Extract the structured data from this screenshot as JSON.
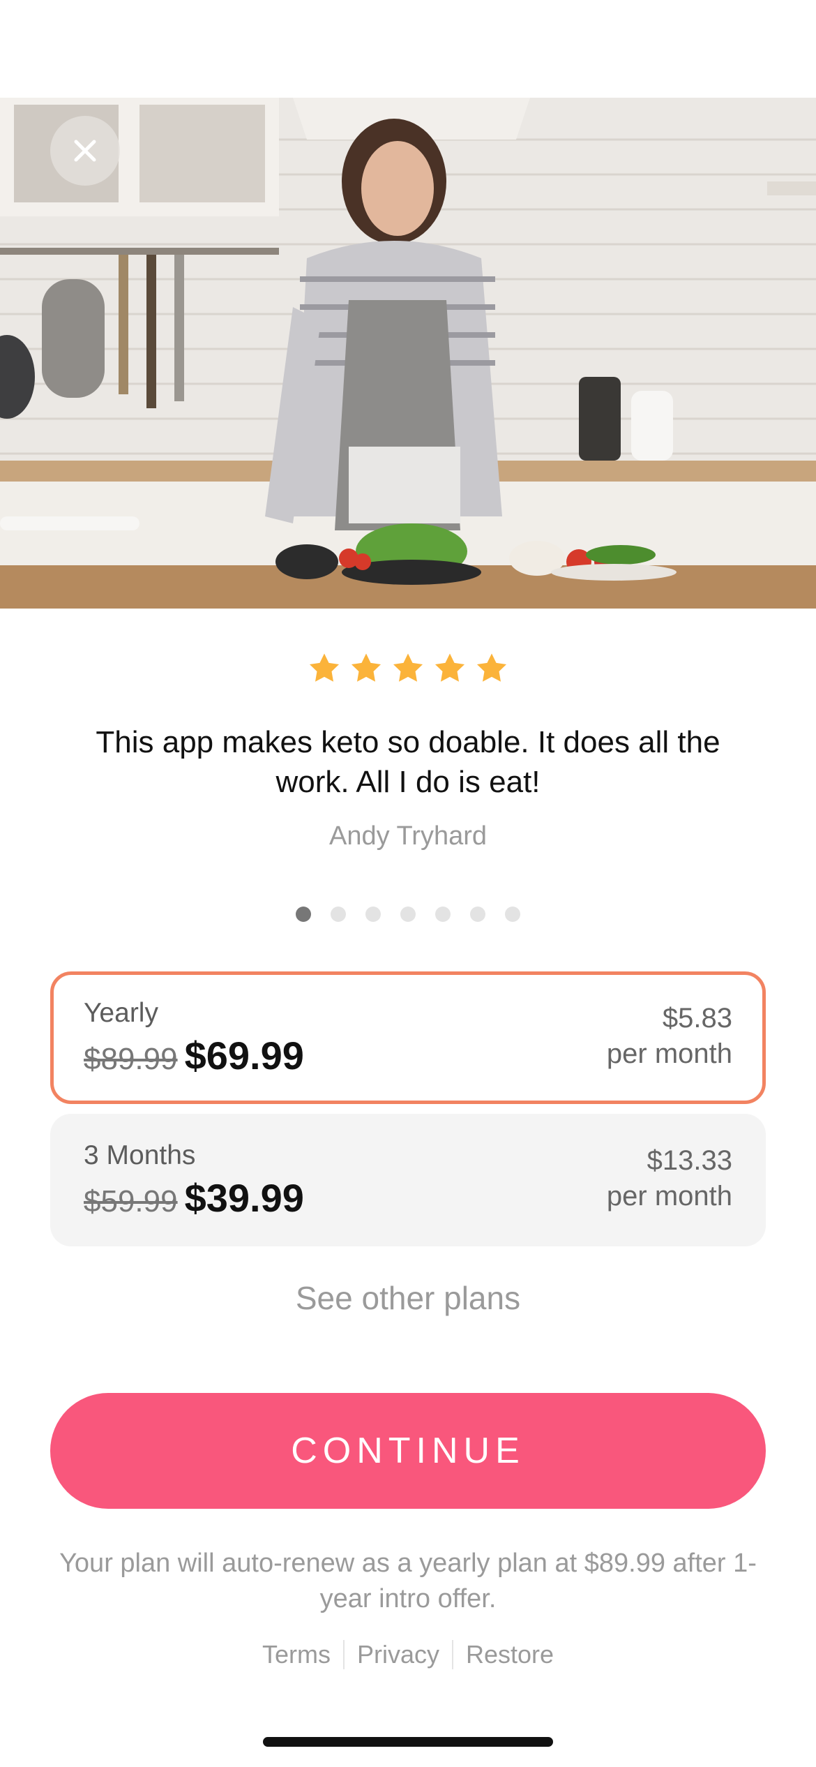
{
  "hero": {
    "image": "woman cooking in kitchen photo"
  },
  "close": {
    "icon": "close-icon"
  },
  "review": {
    "stars": 5,
    "star_color": "#fbb33a",
    "quote": "This app makes keto so doable. It does all the work. All I do is eat!",
    "author": "Andy Tryhard"
  },
  "pager": {
    "total": 7,
    "active": 1
  },
  "plans": [
    {
      "name": "Yearly",
      "old_price": "$89.99",
      "price": "$69.99",
      "per_month_price": "$5.83",
      "per_month_label": "per month",
      "selected": true
    },
    {
      "name": "3 Months",
      "old_price": "$59.99",
      "price": "$39.99",
      "per_month_price": "$13.33",
      "per_month_label": "per month",
      "selected": false
    }
  ],
  "see_other_plans": "See other plans",
  "cta": {
    "label": "CONTINUE",
    "color": "#f9577c"
  },
  "renew_note": "Your plan will auto-renew as a yearly plan at $89.99 after 1-year intro offer.",
  "footer": {
    "terms": "Terms",
    "privacy": "Privacy",
    "restore": "Restore"
  },
  "colors": {
    "selected_border": "#f28361",
    "star": "#fbb33a"
  }
}
